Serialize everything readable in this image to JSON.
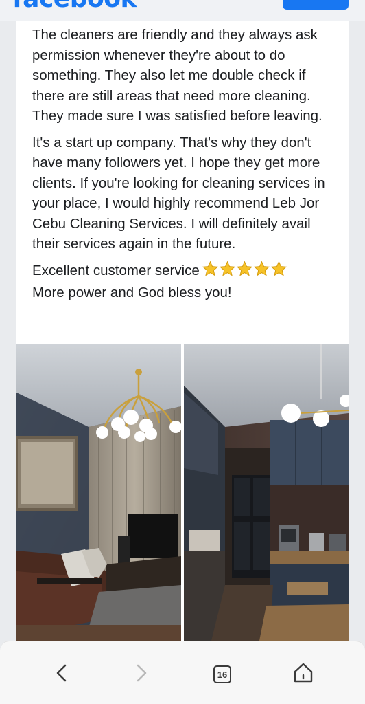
{
  "app": {
    "brand": "facebook"
  },
  "post": {
    "paragraphs": [
      "The cleaners are friendly and they always ask permission whenever they're about to do something. They also let me double check if there are still areas that need more cleaning. They made sure I was satisfied before leaving.",
      "It's a start up company. That's why they don't have many followers yet. I hope they get more clients. If you're looking for cleaning services in your place, I would highly recommend Leb Jor Cebu Cleaning Services. I will definitely avail their services again in the future."
    ],
    "closing_line_1": "Excellent customer service",
    "closing_line_2": "More power and God bless you!",
    "rating_stars": 5,
    "photos": [
      {
        "subject": "living-room-photo"
      },
      {
        "subject": "kitchen-photo"
      }
    ]
  },
  "browser_nav": {
    "back_icon": "chevron-left-icon",
    "forward_icon": "chevron-right-icon",
    "tab_count": "16",
    "home_icon": "home-icon"
  },
  "colors": {
    "brand_blue": "#1877f2",
    "text": "#1c1e21",
    "star": "#f6c228"
  }
}
